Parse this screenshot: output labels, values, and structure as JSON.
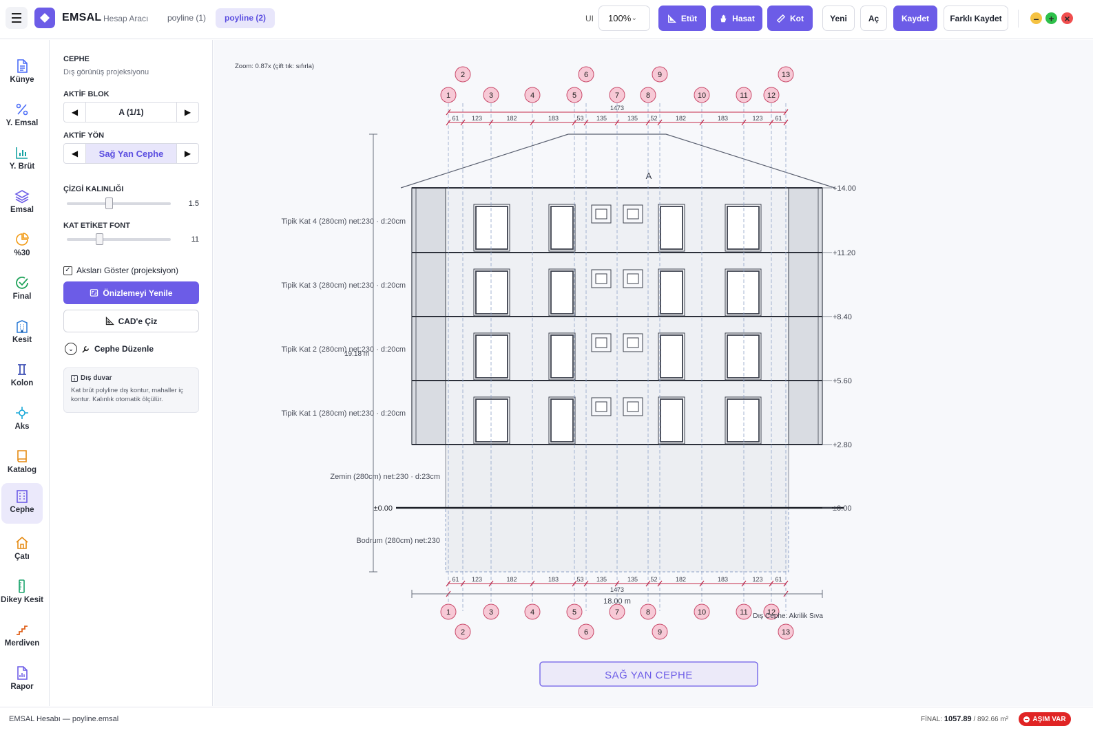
{
  "app": {
    "brand": "EMSAL",
    "subtitle": "Hesap Aracı",
    "logo_icon": "diamond-icon",
    "accent": "#6c5ce7"
  },
  "file_tabs": [
    {
      "label": "poyline (1)",
      "active": false
    },
    {
      "label": "poyline (2)",
      "active": true
    }
  ],
  "toolbar": {
    "ui_label": "UI",
    "zoom_value": "100%",
    "etut_label": "Etüt",
    "hasat_label": "Hasat",
    "kot_label": "Kot",
    "yeni_label": "Yeni",
    "ac_label": "Aç",
    "kaydet_label": "Kaydet",
    "farkli_label": "Farklı Kaydet"
  },
  "rail": [
    {
      "label": "Künye",
      "icon": "document-icon",
      "color": "#4a6cf7"
    },
    {
      "label": "Y. Emsal",
      "icon": "percent-icon",
      "color": "#4a6cf7"
    },
    {
      "label": "Y. Brüt",
      "icon": "bar-chart-icon",
      "color": "#16a3a3"
    },
    {
      "label": "Emsal",
      "icon": "layers-icon",
      "color": "#6c5ce7"
    },
    {
      "label": "%30",
      "icon": "pie-icon",
      "color": "#f29a13"
    },
    {
      "label": "Final",
      "icon": "check-circle-icon",
      "color": "#20a35a"
    },
    {
      "label": "Kesit",
      "icon": "building-icon",
      "color": "#2a7ad6"
    },
    {
      "label": "Kolon",
      "icon": "column-icon",
      "color": "#3f51b5"
    },
    {
      "label": "Aks",
      "icon": "crosshair-icon",
      "color": "#18a8d8"
    },
    {
      "label": "Katalog",
      "icon": "book-icon",
      "color": "#e58a12"
    },
    {
      "label": "Cephe",
      "icon": "facade-icon",
      "color": "#6c5ce7",
      "active": true
    },
    {
      "label": "Çatı",
      "icon": "house-icon",
      "color": "#e58a12"
    },
    {
      "label": "Dikey Kesit",
      "icon": "ruler-icon",
      "color": "#18a36b"
    },
    {
      "label": "Merdiven",
      "icon": "stairs-icon",
      "color": "#e0601a"
    },
    {
      "label": "Rapor",
      "icon": "report-icon",
      "color": "#6c5ce7"
    }
  ],
  "panel": {
    "title": "CEPHE",
    "subtitle": "Dış görünüş projeksiyonu",
    "aktif_blok_label": "AKTİF BLOK",
    "aktif_blok_value": "A  (1/1)",
    "aktif_yon_label": "AKTİF YÖN",
    "aktif_yon_value": "Sağ Yan Cephe",
    "cizgi_label": "ÇİZGİ KALINLIĞI",
    "cizgi_value": "1.5",
    "cizgi_fraction": 0.4,
    "font_label": "KAT ETİKET FONT",
    "font_value": "11",
    "font_fraction": 0.3,
    "akslari_label": "Aksları Göster (projeksiyon)",
    "akslari_checked": true,
    "onizle_label": "Önizlemeyi Yenile",
    "cad_label": "CAD'e Çiz",
    "cephe_duzenle_label": "Cephe Düzenle",
    "info_title": "Dış duvar",
    "info_body": "Kat brüt polyline dış kontur, mahaller iç kontur. Kalınlık otomatik ölçülür."
  },
  "drawing": {
    "zoom_note": "Zoom: 0.87x  (çift tık: sıfırla)",
    "block_letter": "A",
    "axes": [
      "1",
      "2",
      "3",
      "4",
      "5",
      "6",
      "7",
      "8",
      "9",
      "10",
      "11",
      "12",
      "13"
    ],
    "dim_segments": [
      "61",
      "123",
      "182",
      "183",
      "53",
      "135",
      "135",
      "52",
      "182",
      "183",
      "123",
      "61"
    ],
    "dim_total": "1473",
    "width_label": "18.00 m",
    "height_label": "19.18 m",
    "levels": [
      "+14.00",
      "+11.20",
      "+8.40",
      "+5.60",
      "+2.80",
      "±0.00"
    ],
    "ground_left": "±0.00",
    "floors": [
      "Tipik Kat 4 (280cm) net:230 · d:20cm",
      "Tipik Kat 3 (280cm) net:230 · d:20cm",
      "Tipik Kat 2 (280cm) net:230 · d:20cm",
      "Tipik Kat 1 (280cm) net:230 · d:20cm",
      "Zemin (280cm) net:230 · d:23cm",
      "Bodrum (280cm) net:230"
    ],
    "material_note": "Dış Cephe: Akrilik Sıva",
    "facade_title": "SAĞ YAN CEPHE"
  },
  "status": {
    "file": "EMSAL Hesabı — poyline.emsal",
    "final_label": "FİNAL:",
    "final_value": "1057.89",
    "final_limit": "/ 892.66 m²",
    "badge": "AŞIM VAR",
    "badge_color": "#e02424"
  }
}
